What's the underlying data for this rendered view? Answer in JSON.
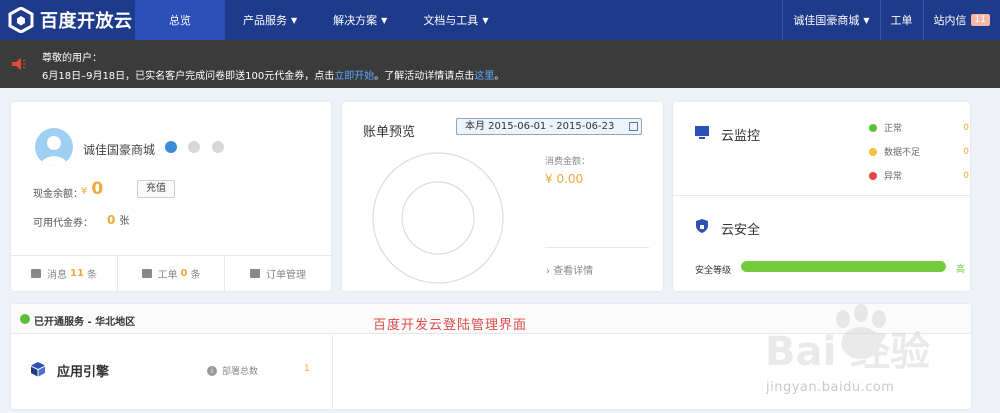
{
  "header": {
    "logo_text": "百度开放云",
    "nav": [
      {
        "label": "总览",
        "active": true
      },
      {
        "label": "产品服务"
      },
      {
        "label": "解决方案"
      },
      {
        "label": "文档与工具"
      }
    ],
    "account": "诚佳国豪商城",
    "ticket": "工单",
    "inbox": "站内信",
    "inbox_count": "11"
  },
  "notice": {
    "greeting": "尊敬的用户：",
    "line_prefix": "6月18日–9月18日，已实名客户完成问卷即送100元代金券，点击",
    "link1": "立即开始",
    "line_mid": "。了解活动详情请点击",
    "link2": "这里",
    "line_end": "。"
  },
  "user": {
    "name": "诚佳国豪商城",
    "balance_label": "现金余额：",
    "currency": "¥",
    "balance": "0",
    "recharge": "充值",
    "coupon_label": "可用代金券：",
    "coupon_count": "0",
    "coupon_unit": "张",
    "footer": {
      "msg_label": "消息",
      "msg_count": "11",
      "msg_unit": "条",
      "ticket_label": "工单",
      "ticket_count": "0",
      "ticket_unit": "条",
      "order_label": "订单管理"
    }
  },
  "bill": {
    "title": "账单预览",
    "range": "本月  2015-06-01 - 2015-06-23",
    "spend_label": "消费金额：",
    "spend_value": "¥ 0.00",
    "details": "查看详情"
  },
  "monitor": {
    "title": "云监控",
    "statuses": [
      {
        "label": "正常",
        "count": "0",
        "color": "#5bbf3a"
      },
      {
        "label": "数据不足",
        "count": "0",
        "color": "#f5c13a"
      },
      {
        "label": "异常",
        "count": "0",
        "color": "#e8453c"
      }
    ],
    "security_title": "云安全",
    "security_label": "安全等级",
    "security_level": "高",
    "security_fill": 1.0
  },
  "services": {
    "header": "已开通服务 - 华北地区",
    "caption": "百度开发云登陆管理界面",
    "name": "应用引擎",
    "deploy_label": "部署总数",
    "deploy_count": "1"
  },
  "watermark": {
    "brand": "Bai 经验",
    "url": "jingyan.baidu.com"
  },
  "colors": {
    "nav_bg": "#1e3a8a",
    "nav_active": "#2c4fb8",
    "accent": "#f0a93b",
    "link": "#5aa7ff",
    "green": "#74cc3c"
  }
}
